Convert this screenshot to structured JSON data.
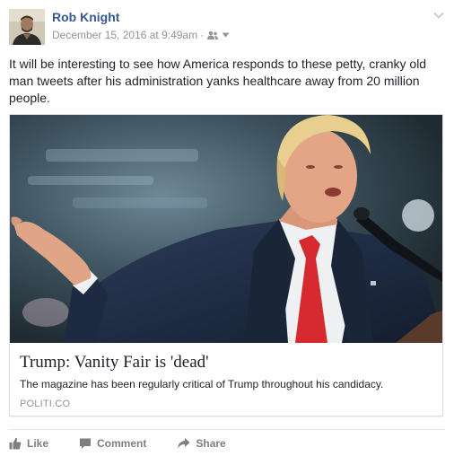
{
  "post": {
    "author": "Rob Knight",
    "timestamp": "December 15, 2016 at 9:49am",
    "separator": "·",
    "body": "It will be interesting to see how America responds to these petty, cranky old man tweets after his administration yanks healthcare away from 20 million people.",
    "audience_icon": "friends-icon",
    "menu_icon": "chevron-down-icon"
  },
  "link": {
    "title": "Trump: Vanity Fair is 'dead'",
    "description": "The magazine has been regularly critical of Trump throughout his candidacy.",
    "domain": "POLITI.CO"
  },
  "actions": {
    "like": "Like",
    "comment": "Comment",
    "share": "Share"
  },
  "colors": {
    "author": "#365899",
    "meta": "#90949c",
    "text": "#1d2129",
    "action": "#7f7f7f",
    "tie": "#d42a30"
  }
}
